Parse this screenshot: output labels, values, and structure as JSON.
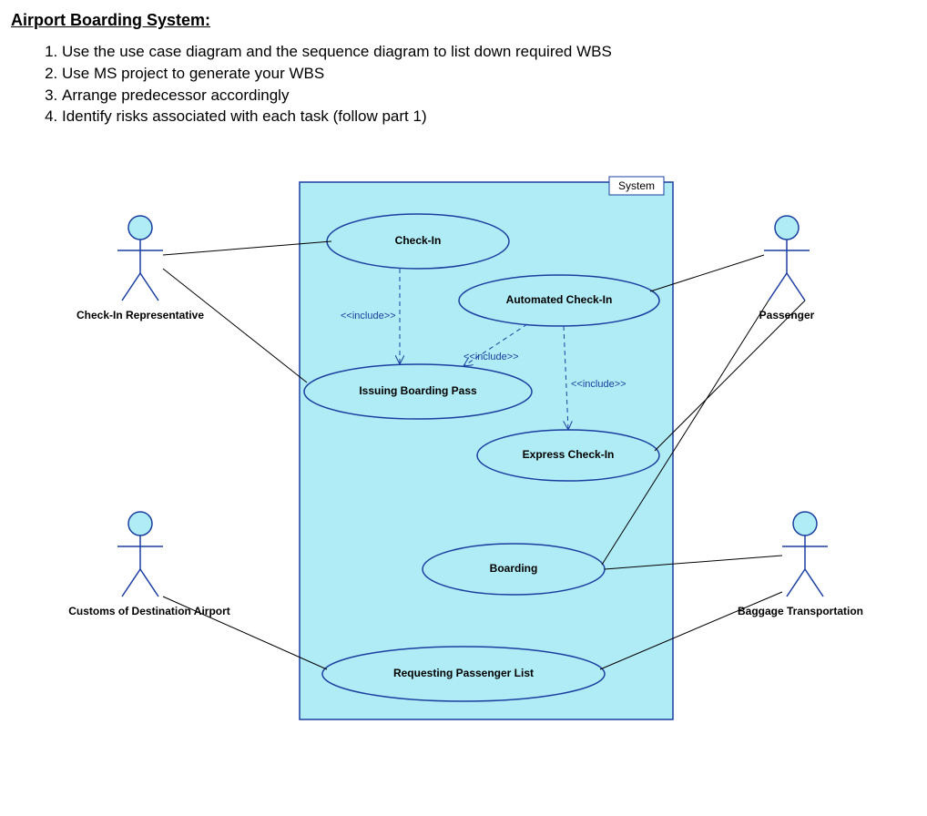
{
  "title": "Airport Boarding System:",
  "instructions": [
    "Use the use case diagram and the sequence diagram to list down required WBS",
    "Use MS project to generate your WBS",
    "Arrange predecessor accordingly",
    "Identify risks associated with each task (follow part 1)"
  ],
  "diagram": {
    "system_label": "System",
    "actors": {
      "a1": "Check-In Representative",
      "a2": "Customs of Destination Airport",
      "a3": "Passenger",
      "a4": "Baggage Transportation"
    },
    "usecases": {
      "u1": "Check-In",
      "u2": "Automated Check-In",
      "u3": "Issuing Boarding Pass",
      "u4": "Express Check-In",
      "u5": "Boarding",
      "u6": "Requesting Passenger List"
    },
    "stereotypes": {
      "s1": "<<include>>",
      "s2": "<<include>>",
      "s3": "<<include>>"
    }
  }
}
